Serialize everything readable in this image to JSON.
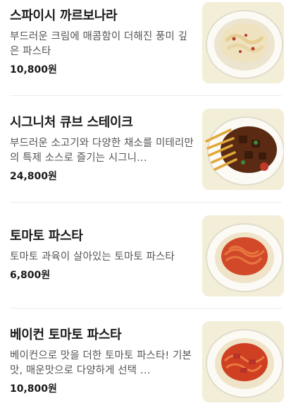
{
  "menu": {
    "items": [
      {
        "name": "스파이시 까르보나라",
        "desc": "부드러운 크림에 매콤함이 더해진 풍미 깊은 파스타",
        "price": "10,800원",
        "photo_icon": "carbonara-photo"
      },
      {
        "name": "시그니처 큐브 스테이크",
        "desc": "부드러운 소고기와 다양한 채소를 미테리만의 특제 소스로 즐기는 시그니…",
        "price": "24,800원",
        "photo_icon": "steak-photo"
      },
      {
        "name": "토마토 파스타",
        "desc": "토마토 과육이 살아있는 토마토 파스타",
        "price": "6,800원",
        "photo_icon": "tomato-pasta-photo"
      },
      {
        "name": "베이컨 토마토 파스타",
        "desc": "베이컨으로 맛을 더한 토마토 파스타! 기본맛, 매운맛으로 다양하게 선택 …",
        "price": "10,800원",
        "photo_icon": "bacon-tomato-pasta-photo"
      }
    ]
  }
}
